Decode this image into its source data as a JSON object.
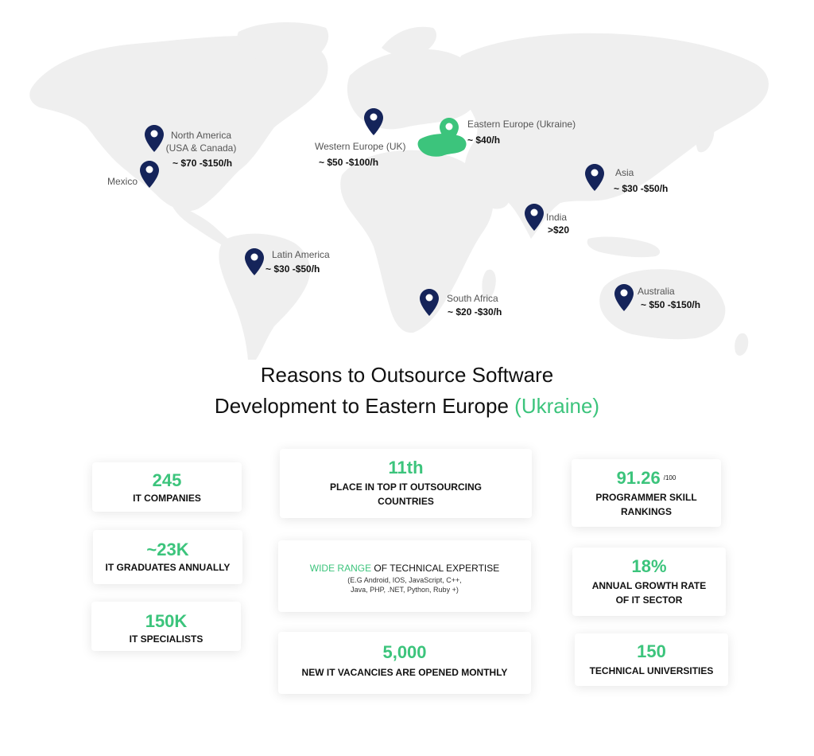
{
  "colors": {
    "accent": "#3cc47c",
    "pin": "#15245a",
    "map": "#efefef"
  },
  "regions": [
    {
      "id": "north-america",
      "lines": [
        "North America",
        "(USA & Canada)"
      ],
      "price": "~ $70 -$150/h"
    },
    {
      "id": "mexico",
      "lines": [
        "Mexico"
      ],
      "price": ""
    },
    {
      "id": "western-europe",
      "lines": [
        "Western Europe (UK)"
      ],
      "price": "~ $50 -$100/h"
    },
    {
      "id": "eastern-europe",
      "lines": [
        "Eastern Europe (Ukraine)"
      ],
      "price": "~ $40/h"
    },
    {
      "id": "asia",
      "lines": [
        "Asia"
      ],
      "price": "~ $30 -$50/h"
    },
    {
      "id": "india",
      "lines": [
        "India"
      ],
      "price": ">$20"
    },
    {
      "id": "latin-america",
      "lines": [
        "Latin America"
      ],
      "price": "~ $30 -$50/h"
    },
    {
      "id": "south-africa",
      "lines": [
        "South Africa"
      ],
      "price": "~ $20 -$30/h"
    },
    {
      "id": "australia",
      "lines": [
        "Australia"
      ],
      "price": "~ $50 -$150/h"
    }
  ],
  "title": {
    "line1": "Reasons to Outsource Software",
    "line2": "Development to Eastern Europe",
    "accent": "(Ukraine)"
  },
  "stats": {
    "companies": {
      "value": "245",
      "label": "IT COMPANIES"
    },
    "graduates": {
      "value": "~23K",
      "label": "IT GRADUATES ANNUALLY"
    },
    "specialists": {
      "value": "150K",
      "label": "IT SPECIALISTS"
    },
    "rank": {
      "value": "11th",
      "label1": "PLACE IN TOP IT OUTSOURCING",
      "label2": "COUNTRIES"
    },
    "expertise": {
      "accent": "WIDE RANGE",
      "label": " OF TECHNICAL EXPERTISE",
      "detail1": "(E.G Android, IOS, JavaScript, C++,",
      "detail2": "Java, PHP, .NET, Python, Ruby +)"
    },
    "vacancies": {
      "value": "5,000",
      "label": "NEW IT VACANCIES ARE OPENED MONTHLY"
    },
    "skill": {
      "value": "91.26",
      "suffix": "/100",
      "label1": "PROGRAMMER SKILL",
      "label2": "RANKINGS"
    },
    "growth": {
      "value": "18%",
      "label1": "ANNUAL GROWTH RATE",
      "label2": "OF IT SECTOR"
    },
    "universities": {
      "value": "150",
      "label": "TECHNICAL UNIVERSITIES"
    }
  }
}
